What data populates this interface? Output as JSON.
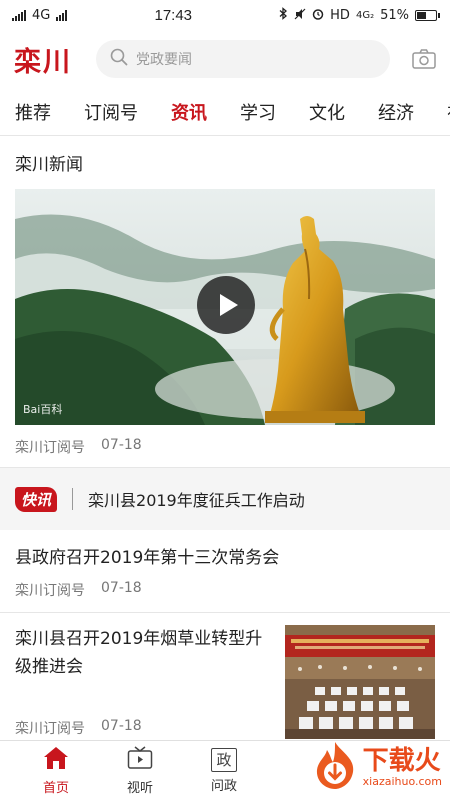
{
  "status_bar": {
    "network": "4G",
    "time": "17:43",
    "hd_network": "HD",
    "hd_sub": "4G₂",
    "battery": "51%",
    "battery_level": 0.51
  },
  "header": {
    "logo": "栾川",
    "search_placeholder": "党政要闻"
  },
  "tabs": [
    {
      "label": "推荐"
    },
    {
      "label": "订阅号"
    },
    {
      "label": "资讯",
      "active": true
    },
    {
      "label": "学习"
    },
    {
      "label": "文化"
    },
    {
      "label": "经济"
    },
    {
      "label": "视频"
    }
  ],
  "feature": {
    "title": "栾川新闻",
    "watermark": "Bai百科",
    "source": "栾川订阅号",
    "date": "07-18"
  },
  "flash": {
    "badge": "快讯",
    "text": "栾川县2019年度征兵工作启动"
  },
  "news": [
    {
      "title": "县政府召开2019年第十三次常务会",
      "source": "栾川订阅号",
      "date": "07-18"
    },
    {
      "title": "栾川县召开2019年烟草业转型升级推进会",
      "source": "栾川订阅号",
      "date": "07-18"
    }
  ],
  "bottom_nav": [
    {
      "label": "首页",
      "icon": "home-icon",
      "active": true
    },
    {
      "label": "视听",
      "icon": "tv-icon"
    },
    {
      "label": "问政",
      "icon": "ask-gov-icon",
      "glyph": "政"
    }
  ],
  "site_badge": {
    "name": "下载火",
    "url": "xiazaihuo.com"
  },
  "colors": {
    "accent": "#c8161d",
    "site_orange": "#e84a1a"
  }
}
